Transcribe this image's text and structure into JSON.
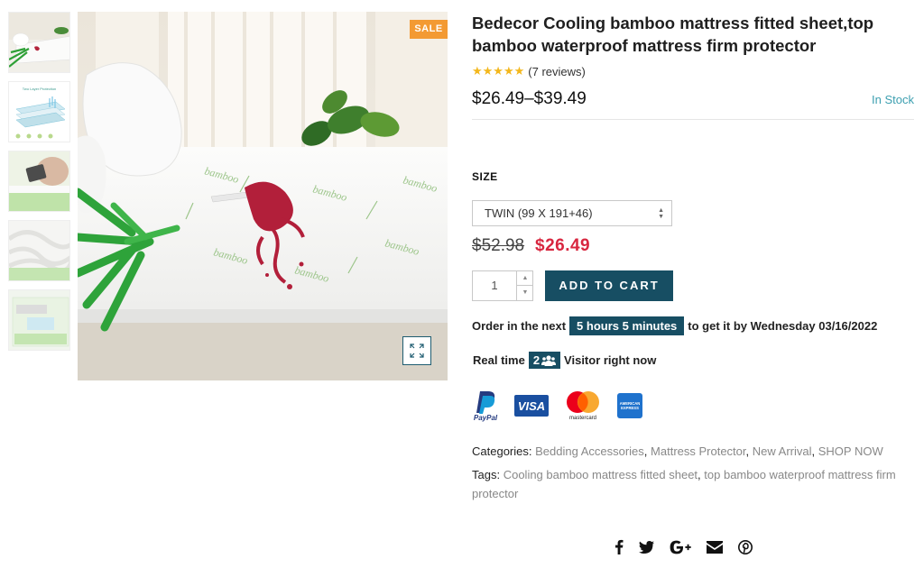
{
  "product": {
    "title": "Bedecor Cooling bamboo mattress fitted sheet,top bamboo waterproof mattress firm protector",
    "sale_badge": "SALE",
    "stars": "★★★★★",
    "rating_value": 5,
    "reviews_text": "(7 reviews)",
    "price_range": "$26.49–$39.49",
    "stock": "In Stock"
  },
  "gallery": {
    "thumb_caption": "Two Layer Protection"
  },
  "options": {
    "size_label": "SIZE",
    "size_selected": "TWIN (99 X 191+46)",
    "old_price": "$52.98",
    "new_price": "$26.49"
  },
  "cart": {
    "quantity": "1",
    "add_to_cart": "ADD TO CART"
  },
  "delivery": {
    "prefix": "Order in the next",
    "countdown": "5 hours 5 minutes",
    "suffix": "to get it by Wednesday 03/16/2022"
  },
  "visitors": {
    "prefix": "Real time",
    "count": "2",
    "suffix": "Visitor right now"
  },
  "payments": {
    "paypal": "PayPal",
    "visa": "VISA",
    "mastercard": "mastercard",
    "amex": "AMERICAN EXPRESS"
  },
  "categories": {
    "label": "Categories:",
    "items": [
      "Bedding Accessories",
      "Mattress Protector",
      "New Arrival",
      "SHOP NOW"
    ]
  },
  "tags": {
    "label": "Tags:",
    "items": [
      "Cooling bamboo mattress fitted sheet",
      "top bamboo waterproof mattress firm protector"
    ]
  },
  "share": {
    "icons": [
      "facebook-icon",
      "twitter-icon",
      "google-plus-icon",
      "email-icon",
      "pinterest-icon"
    ]
  },
  "colors": {
    "accent": "#174e63",
    "sale": "#f39a33",
    "price_red": "#d8263f",
    "stock": "#3c9fb0",
    "stars": "#f3b71c"
  }
}
